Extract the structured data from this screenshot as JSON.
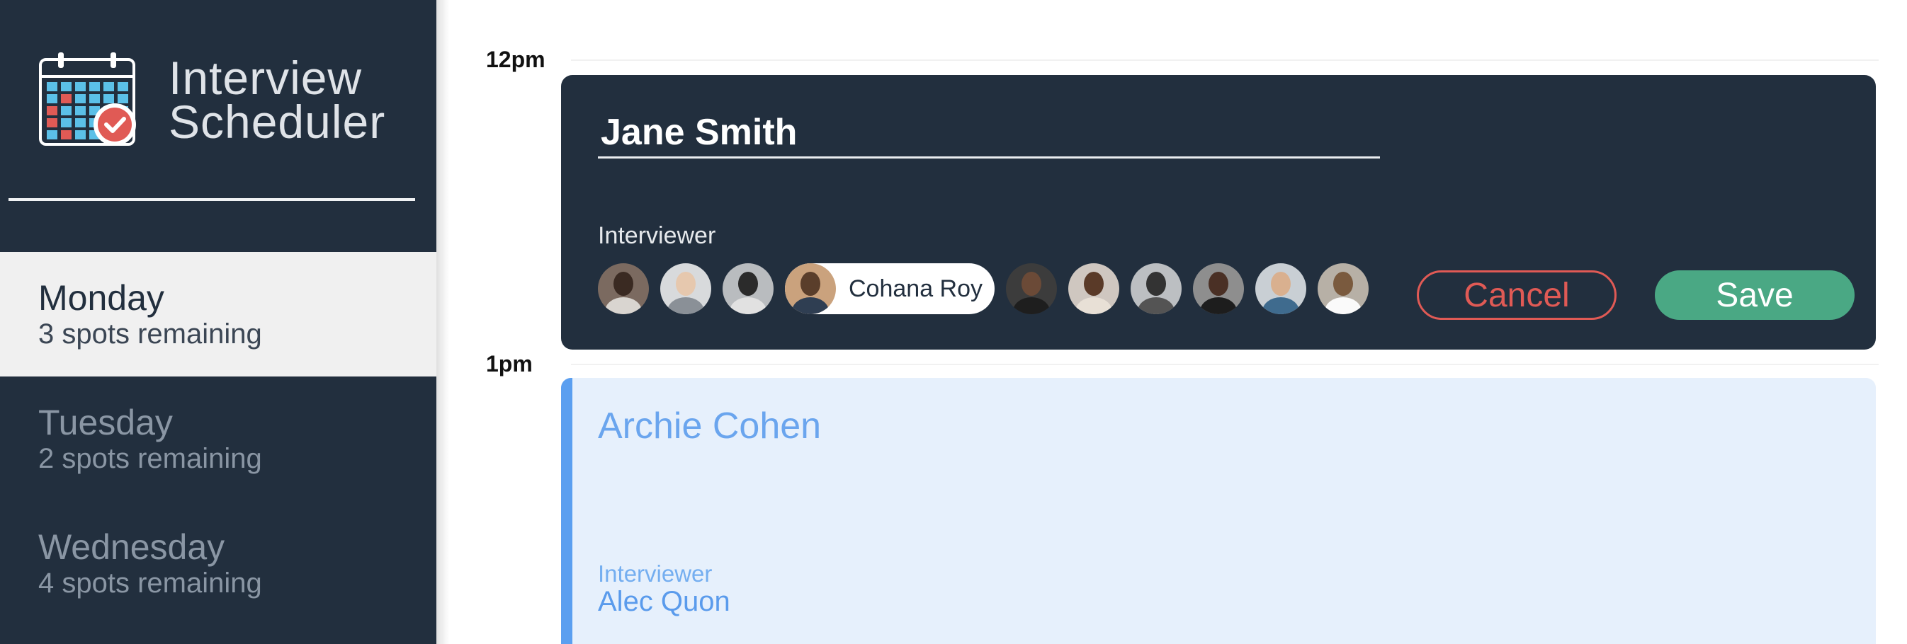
{
  "brand": {
    "title_line1": "Interview",
    "title_line2": "Scheduler",
    "icon": "calendar-check-icon"
  },
  "days": [
    {
      "name": "Monday",
      "spots": "3 spots remaining",
      "selected": true
    },
    {
      "name": "Tuesday",
      "spots": "2 spots remaining",
      "selected": false
    },
    {
      "name": "Wednesday",
      "spots": "4 spots remaining",
      "selected": false
    }
  ],
  "schedule": {
    "times": [
      "12pm",
      "1pm"
    ],
    "edit": {
      "student_name": "Jane Smith",
      "interviewer_label": "Interviewer",
      "selected_interviewer": "Cohana Roy",
      "interviewer_count": 10,
      "selected_index": 3,
      "cancel_label": "Cancel",
      "save_label": "Save"
    },
    "appointment": {
      "student_name": "Archie Cohen",
      "interviewer_label": "Interviewer",
      "interviewer_name": "Alec Quon"
    }
  },
  "colors": {
    "sidebar_bg": "#222f3e",
    "selected_day_bg": "#f0f0f0",
    "edit_card_bg": "#222f3e",
    "cancel": "#e05a55",
    "save": "#4aa884",
    "appointment_bg": "#e6f0fc",
    "appointment_accent": "#5b9ff0"
  }
}
